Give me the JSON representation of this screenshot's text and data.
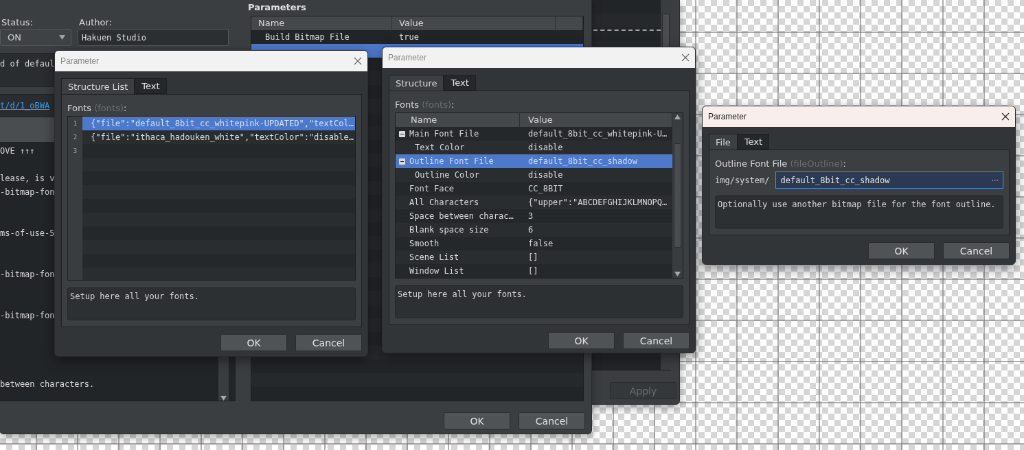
{
  "editor": {
    "status": {
      "label": "Status:",
      "value": "ON"
    },
    "author": {
      "label": "Author:",
      "value": "Hakuen Studio"
    },
    "description": "d of defaul",
    "link": "t/d/1_oBWA",
    "help": "OVE ↑↑↑\n\nlease, is v\n-bitmap-fon\n\n\nms-of-use-5\n\n\n-bitmap-fon\n\n\n-bitmap-fon\n\n\n\n\nbetween characters.",
    "parameters": {
      "title": "Parameters",
      "columns": [
        "Name",
        "Value"
      ],
      "rows": [
        {
          "name": "Build Bitmap File",
          "value": "true",
          "selected": false
        },
        {
          "selected": true
        }
      ]
    },
    "buttons": [
      {
        "label": "OK"
      },
      {
        "label": "Cancel"
      }
    ]
  },
  "side_window": {
    "buttons": [
      {
        "label": "Apply",
        "disabled": true
      }
    ]
  },
  "dialogs": [
    {
      "kind": "list",
      "title": "Parameter",
      "active": false,
      "tabs": [
        {
          "label": "Structure List",
          "selected": true
        },
        {
          "label": "Text",
          "selected": false
        }
      ],
      "field": {
        "label": "Fonts",
        "key": "(fonts)",
        "end": ":"
      },
      "lines": [
        {
          "number": "1",
          "text": "{\"file\":\"default_8bit_cc_whitepink-UPDATED\",\"textCol…",
          "selected": true
        },
        {
          "number": "2",
          "text": "{\"file\":\"ithaca_hadouken_white\",\"textColor\":\"disable…",
          "selected": false
        },
        {
          "number": "3",
          "selected": false
        }
      ],
      "description": "Setup here all your fonts.",
      "buttons": [
        {
          "label": "OK"
        },
        {
          "label": "Cancel"
        }
      ]
    },
    {
      "kind": "tree",
      "title": "Parameter",
      "active": false,
      "tabs": [
        {
          "label": "Structure",
          "selected": true
        },
        {
          "label": "Text",
          "selected": false
        }
      ],
      "field": {
        "label": "Fonts",
        "key": "(fonts)",
        "end": ":"
      },
      "columns": [
        "Name",
        "Value"
      ],
      "rows": [
        {
          "name": "Main Font File",
          "value": "default_8bit_cc_whitepink-U…",
          "selected": false,
          "expanded": true,
          "children": [
            {
              "name": "Text Color",
              "value": "disable",
              "selected": false
            }
          ]
        },
        {
          "name": "Outline Font File",
          "value": "default_8bit_cc_shadow",
          "selected": true,
          "expanded": true,
          "children": [
            {
              "name": "Outline Color",
              "value": "disable",
              "selected": false
            }
          ]
        },
        {
          "name": "Font Face",
          "value": "CC_8BIT",
          "selected": false
        },
        {
          "name": "All Characters",
          "value": "{\"upper\":\"ABCDEFGHIJKLMNOPQ…",
          "selected": false
        },
        {
          "name": "Space between charac…",
          "value": "3",
          "selected": false
        },
        {
          "name": "Blank space size",
          "value": "6",
          "selected": false
        },
        {
          "name": "Smooth",
          "value": "false",
          "selected": false
        },
        {
          "name": "Scene List",
          "value": "[]",
          "selected": false
        },
        {
          "name": "Window List",
          "value": "[]",
          "selected": false
        }
      ],
      "description": "Setup here all your fonts.",
      "buttons": [
        {
          "label": "OK"
        },
        {
          "label": "Cancel"
        }
      ]
    },
    {
      "kind": "file",
      "title": "Parameter",
      "active": true,
      "tabs": [
        {
          "label": "File",
          "selected": true
        },
        {
          "label": "Text",
          "selected": false
        }
      ],
      "field": {
        "label": "Outline Font File",
        "key": "(fileOutline)",
        "end": ":"
      },
      "prefix": "img/system/",
      "value": "default_8bit_cc_shadow",
      "focused": true,
      "browse": "···",
      "description": "Optionally use another bitmap file for the font outline.",
      "buttons": [
        {
          "label": "OK"
        },
        {
          "label": "Cancel"
        }
      ]
    }
  ]
}
